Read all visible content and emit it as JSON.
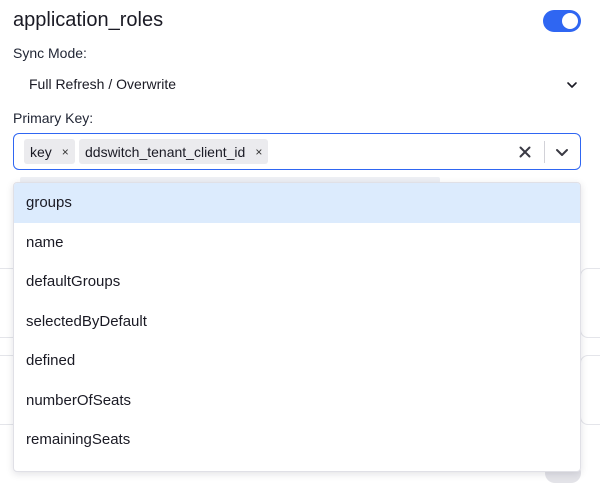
{
  "stream": {
    "title": "application_roles",
    "enabled": true
  },
  "sync_mode": {
    "label": "Sync Mode:",
    "value": "Full Refresh / Overwrite",
    "chevron_icon": "chevron-down-icon"
  },
  "primary_key": {
    "label": "Primary Key:",
    "chips": [
      {
        "label": "key",
        "remove_icon": "×"
      },
      {
        "label": "ddswitch_tenant_client_id",
        "remove_icon": "×"
      }
    ],
    "clear_icon": "clear-icon",
    "dropdown_icon": "chevron-down-icon"
  },
  "dropdown": {
    "options": [
      {
        "label": "groups",
        "highlighted": true
      },
      {
        "label": "name"
      },
      {
        "label": "defaultGroups"
      },
      {
        "label": "selectedByDefault"
      },
      {
        "label": "defined"
      },
      {
        "label": "numberOfSeats"
      },
      {
        "label": "remainingSeats"
      }
    ]
  },
  "colors": {
    "accent": "#2f66f2",
    "highlight": "#dcebfd",
    "chip": "#ebebee"
  }
}
